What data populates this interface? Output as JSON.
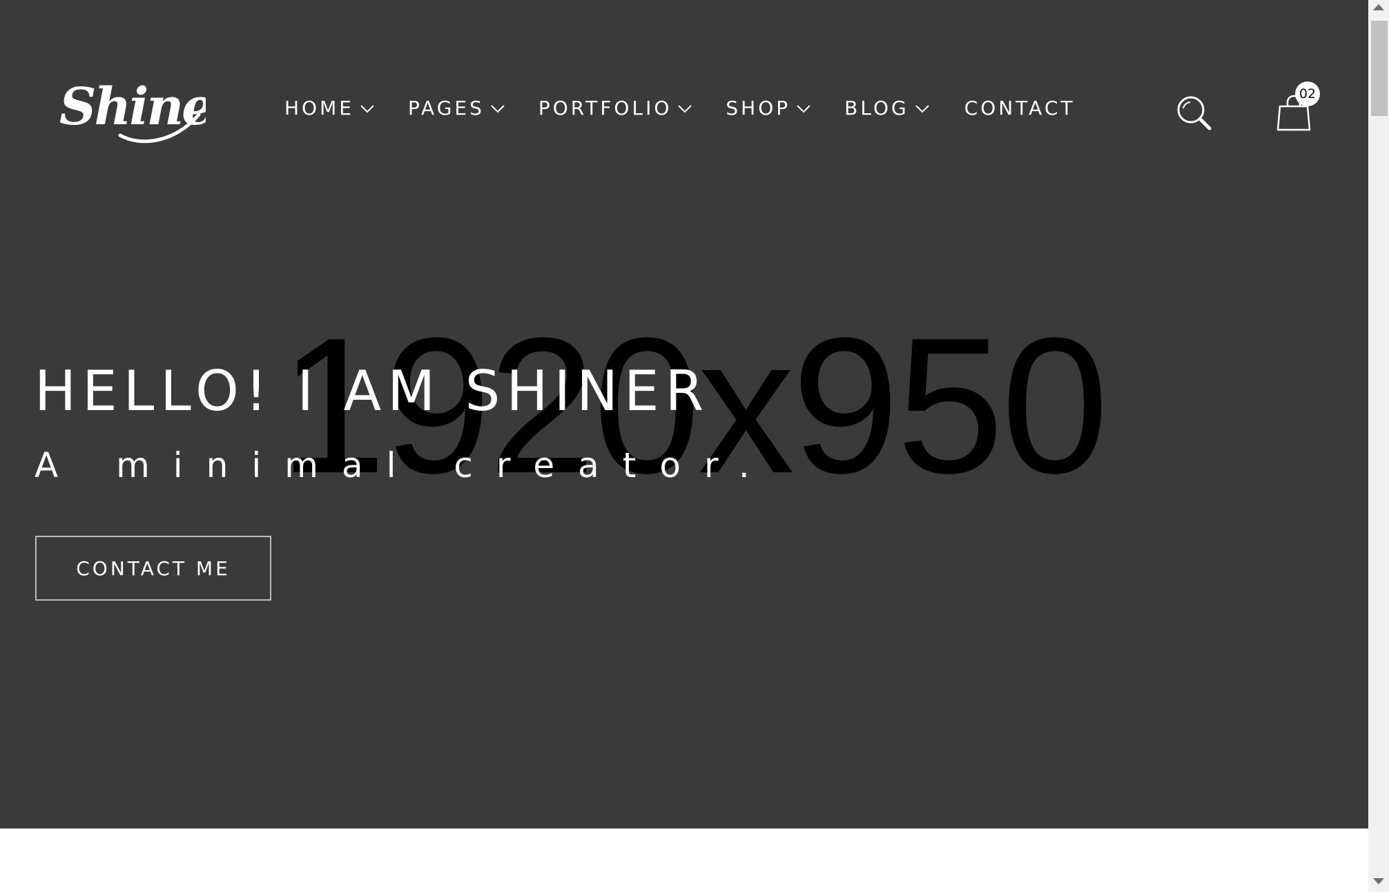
{
  "header": {
    "logo_text": "Shine",
    "nav": {
      "home": "HOME",
      "pages": "PAGES",
      "portfolio": "PORTFOLIO",
      "shop": "SHOP",
      "blog": "BLOG",
      "contact": "CONTACT"
    },
    "cart_count": "02",
    "icons": {
      "search": "search-icon",
      "cart": "shopping-bag-icon",
      "dropdown": "chevron-down-icon"
    }
  },
  "hero": {
    "placeholder_text": "1920x950",
    "title": "HELLO! I AM SHINER",
    "subtitle": "A minimal creator.",
    "cta_label": "CONTACT ME",
    "background_color": "#3a3a3a"
  }
}
